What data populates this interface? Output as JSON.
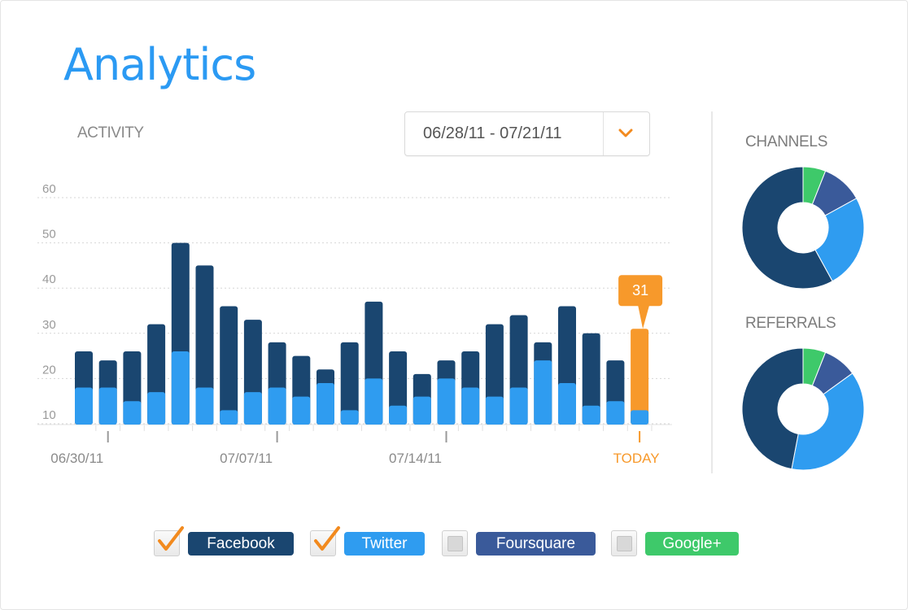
{
  "header": {
    "title": "Analytics"
  },
  "activity_label": "ACTIVITY",
  "date_range": {
    "value": "06/28/11 - 07/21/11"
  },
  "side": {
    "channels_title": "CHANNELS",
    "referrals_title": "REFERRALS"
  },
  "colors": {
    "facebook": "#1a4670",
    "twitter": "#2f9cf0",
    "foursquare": "#3a5a9a",
    "google": "#3ec96a",
    "highlight": "#f7992b",
    "title_blue": "#2b9af3"
  },
  "chart_data": {
    "type": "bar",
    "stacked": true,
    "ylim": [
      5,
      62
    ],
    "yticks": [
      "60",
      "50",
      "40",
      "30",
      "20",
      "10"
    ],
    "ytick_values": [
      60,
      50,
      40,
      30,
      20,
      10
    ],
    "grid": true,
    "xtick_labels": [
      "06/30/11",
      "07/07/11",
      "07/14/11",
      "TODAY"
    ],
    "xtick_indices": [
      1,
      8,
      15,
      23
    ],
    "categories_count": 24,
    "series": [
      {
        "values": [
          18,
          18,
          15,
          17,
          26,
          18,
          13,
          17,
          18,
          16,
          19,
          13,
          20,
          14,
          16,
          20,
          18,
          16,
          18,
          24,
          19,
          14,
          15,
          13
        ]
      },
      {
        "values": [
          26,
          24,
          26,
          32,
          50,
          45,
          36,
          33,
          28,
          25,
          22,
          28,
          37,
          26,
          21,
          24,
          26,
          32,
          34,
          28,
          36,
          30,
          24,
          31
        ]
      }
    ],
    "highlight": {
      "index": 23,
      "label": "31"
    }
  },
  "donuts": {
    "channels": {
      "slices": [
        0.06,
        0.11,
        0.25,
        0.58
      ]
    },
    "referrals": {
      "slices": [
        0.06,
        0.09,
        0.38,
        0.47
      ]
    }
  },
  "legend": {
    "facebook": {
      "label": "Facebook",
      "checked": true
    },
    "twitter": {
      "label": "Twitter",
      "checked": true
    },
    "foursquare": {
      "label": "Foursquare",
      "checked": false
    },
    "google": {
      "label": "Google+",
      "checked": false
    }
  }
}
